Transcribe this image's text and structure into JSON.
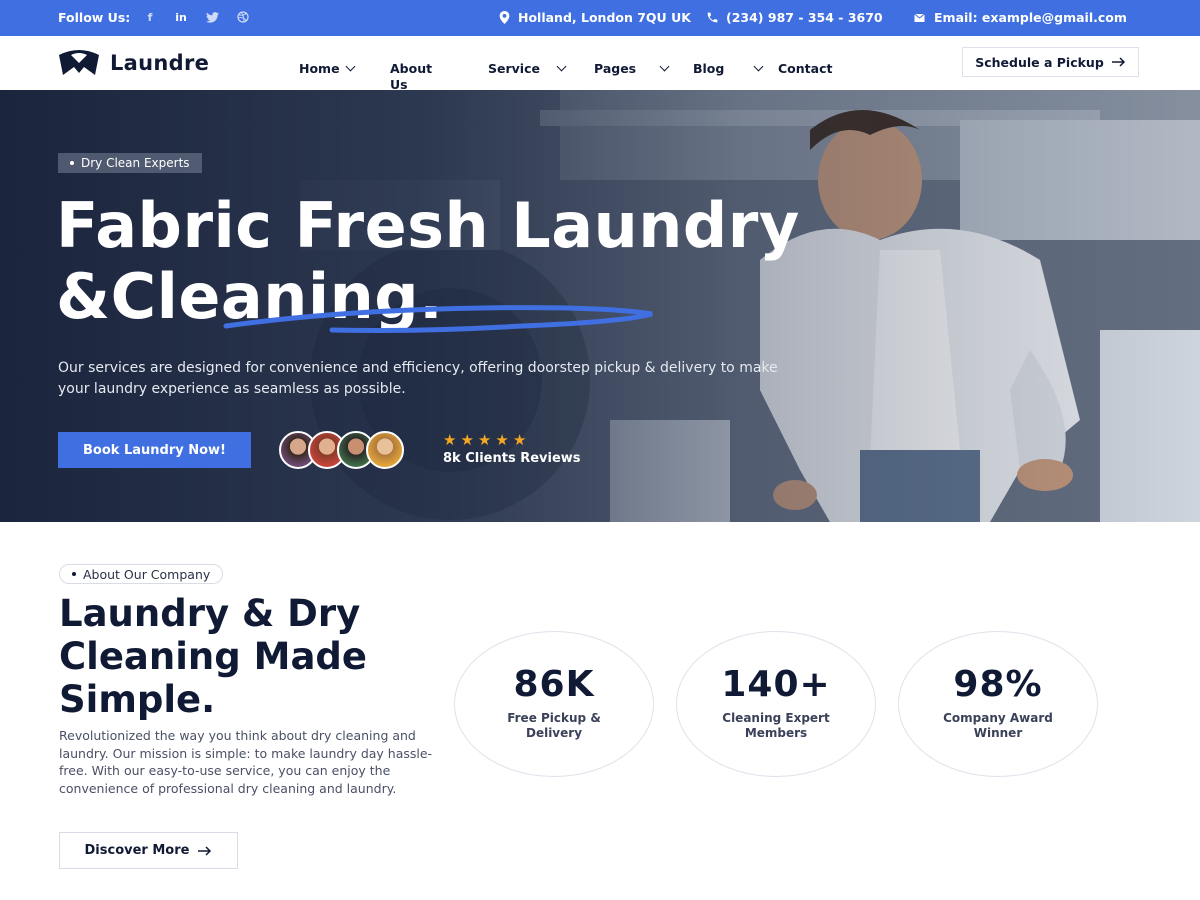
{
  "topbar": {
    "follow_label": "Follow Us:",
    "socials": [
      "facebook-icon",
      "linkedin-icon",
      "twitter-icon",
      "dribbble-icon"
    ],
    "address": "Holland, London 7QU UK",
    "phone": "(234) 987 - 354 - 3670",
    "email": "Email: example@gmail.com"
  },
  "nav": {
    "logo_text": "Laundre",
    "items": [
      {
        "label": "Home",
        "has_dropdown": true
      },
      {
        "label": "About Us",
        "has_dropdown": false
      },
      {
        "label": "Service",
        "has_dropdown": true
      },
      {
        "label": "Pages",
        "has_dropdown": true
      },
      {
        "label": "Blog",
        "has_dropdown": true
      },
      {
        "label": "Contact",
        "has_dropdown": false
      }
    ],
    "cta_label": "Schedule a Pickup"
  },
  "hero": {
    "badge": "Dry Clean Experts",
    "title_line1": "Fabric Fresh Laundry",
    "title_line2": "&Cleaning.",
    "description": "Our services are designed for convenience and efficiency, offering doorstep pickup & delivery to make your laundry experience as seamless as possible.",
    "button_label": "Book Laundry Now!",
    "rating": 5,
    "reviews_label": "8k Clients Reviews"
  },
  "about": {
    "badge": "About Our Company",
    "title": "Laundry & Dry Cleaning Made Simple.",
    "description": "Revolutionized the way you think about dry cleaning and laundry. Our mission is simple: to make laundry day hassle-free. With our easy-to-use service, you can enjoy the convenience of professional dry cleaning and laundry.",
    "button_label": "Discover More",
    "stats": [
      {
        "value": "86K",
        "label": "Free Pickup & Delivery"
      },
      {
        "value": "140+",
        "label": "Cleaning Expert Members"
      },
      {
        "value": "98%",
        "label": "Company Award Winner"
      }
    ]
  },
  "colors": {
    "brand_blue": "#3f6fe0",
    "dark_navy": "#111a35",
    "star": "#f5a623"
  }
}
